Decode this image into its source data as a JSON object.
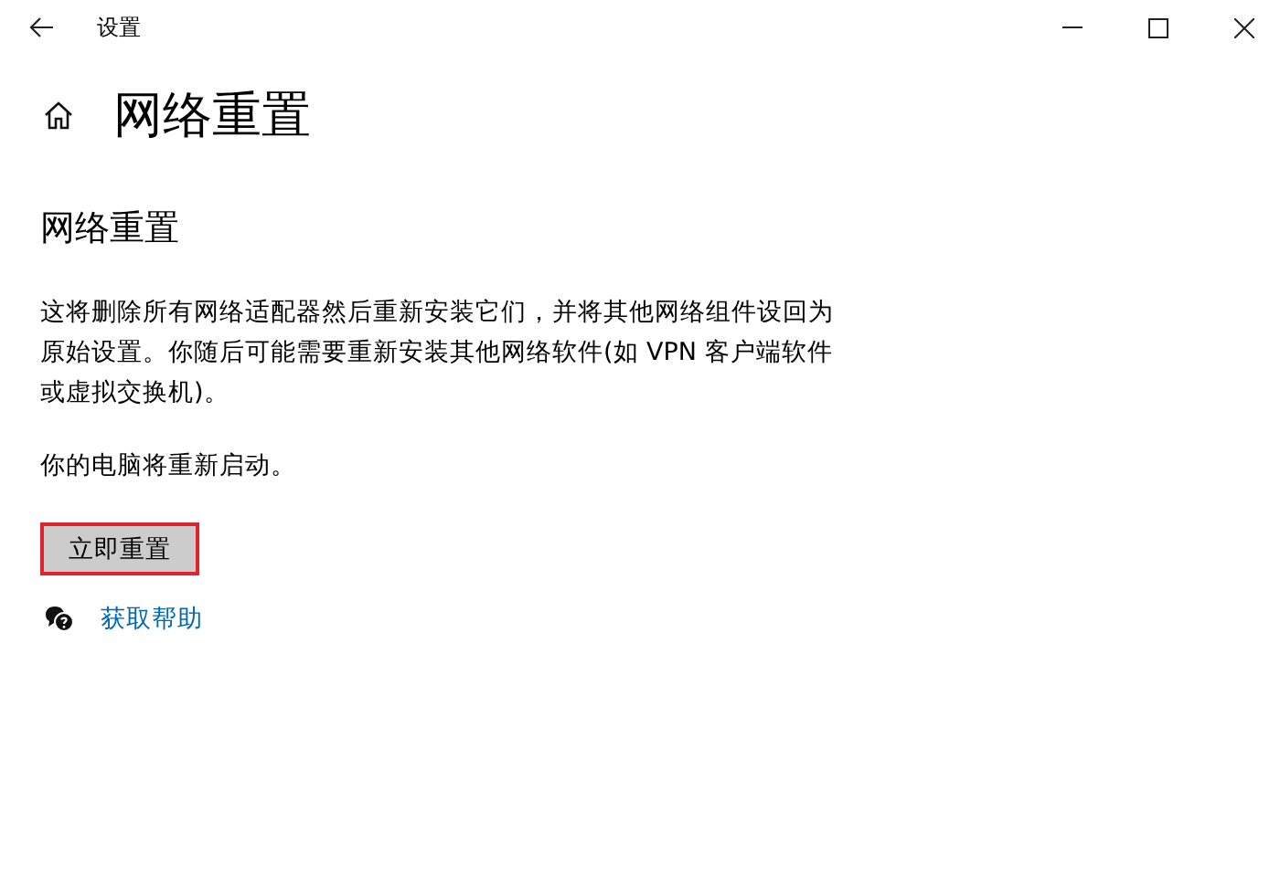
{
  "window": {
    "title": "设置"
  },
  "page": {
    "title": "网络重置"
  },
  "section": {
    "heading": "网络重置",
    "description": "这将删除所有网络适配器然后重新安装它们，并将其他网络组件设回为原始设置。你随后可能需要重新安装其他网络软件(如 VPN 客户端软件或虚拟交换机)。",
    "note": "你的电脑将重新启动。"
  },
  "reset_button": {
    "label": "立即重置",
    "highlighted": true
  },
  "help_link": {
    "label": "获取帮助"
  }
}
